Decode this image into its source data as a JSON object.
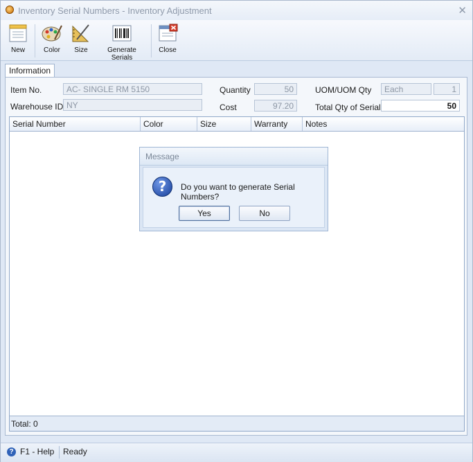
{
  "window": {
    "title": "Inventory Serial Numbers - Inventory Adjustment",
    "close_glyph": "✕"
  },
  "toolbar": {
    "new_label": "New",
    "color_label": "Color",
    "size_label": "Size",
    "generate_label": "Generate Serials",
    "close_label": "Close"
  },
  "tabs": {
    "information": "Information"
  },
  "form": {
    "item_no_label": "Item No.",
    "item_no_value": "AC- SINGLE RM 5150",
    "warehouse_label": "Warehouse ID",
    "warehouse_value": "NY",
    "quantity_label": "Quantity",
    "quantity_value": "50",
    "cost_label": "Cost",
    "cost_value": "97.20",
    "uom_label": "UOM/UOM Qty",
    "uom_value": "Each",
    "uom_qty_value": "1",
    "total_label": "Total Qty of Serials",
    "total_value": "50"
  },
  "grid": {
    "columns": [
      "Serial Number",
      "Color",
      "Size",
      "Warranty",
      "Notes"
    ],
    "footer": "Total: 0"
  },
  "dialog": {
    "title": "Message",
    "message": "Do you want to generate Serial Numbers?",
    "yes_label": "Yes",
    "no_label": "No",
    "icon_glyph": "?"
  },
  "status": {
    "help": "F1 - Help",
    "state": "Ready",
    "help_glyph": "?"
  },
  "colors": {
    "accent": "#2f62b8",
    "window_bg": "#dfe8f5"
  }
}
